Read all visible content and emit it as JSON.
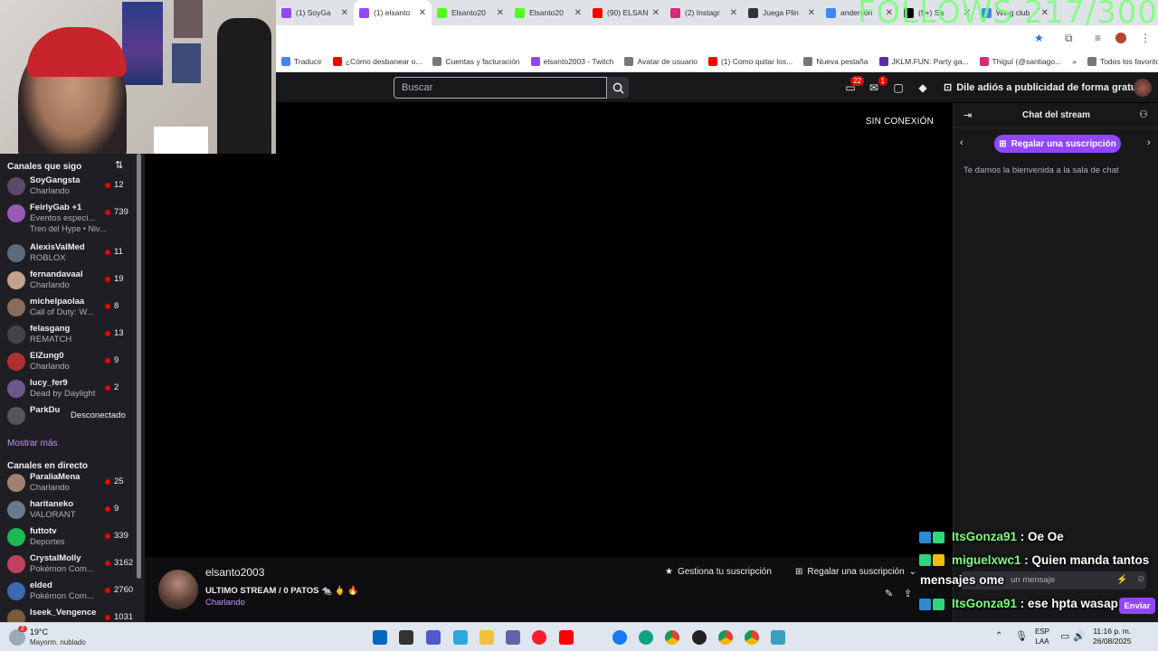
{
  "browser": {
    "tabs": [
      {
        "label": "(1) SoyGa",
        "color": "#9147ff",
        "active": false
      },
      {
        "label": "(1) elsanto",
        "color": "#9147ff",
        "active": true
      },
      {
        "label": "Elsanto20",
        "color": "#53fc18",
        "active": false
      },
      {
        "label": "Elsanto20",
        "color": "#53fc18",
        "active": false
      },
      {
        "label": "(90) ELSAN",
        "color": "#ff0000",
        "active": false
      },
      {
        "label": "(2) Instagr",
        "color": "#d62976",
        "active": false
      },
      {
        "label": "Juega Plin",
        "color": "#333333",
        "active": false
      },
      {
        "label": "anderson",
        "color": "#4285f4",
        "active": false
      },
      {
        "label": "(9+) Sa",
        "color": "#000000",
        "active": false
      },
      {
        "label": "Wing club",
        "color": "#4285f4",
        "active": false
      }
    ],
    "bookmarks": [
      {
        "label": "Traducir",
        "color": "#4285f4"
      },
      {
        "label": "¿Cómo desbanear o...",
        "color": "#ff0000"
      },
      {
        "label": "Cuentas y facturación",
        "color": "#777777"
      },
      {
        "label": "elsanto2003 - Twitch",
        "color": "#9147ff"
      },
      {
        "label": "Avatar de usuario",
        "color": "#777777"
      },
      {
        "label": "(1) Como quitar los...",
        "color": "#ff0000"
      },
      {
        "label": "Nueva pestaña",
        "color": "#777777"
      },
      {
        "label": "JKLM.FUN: Party ga...",
        "color": "#5b2ca0"
      },
      {
        "label": "Thiguí (@santiago...",
        "color": "#d62976"
      }
    ],
    "all_bookmarks": "Todos los favoritos"
  },
  "overlay": {
    "follows": "FOLLOWS 217/300"
  },
  "topbar": {
    "search_placeholder": "Buscar",
    "inbox_badge": "22",
    "notif_badge": "1",
    "ad_link": "Dile adiós a publicidad de forma gratuita"
  },
  "sidebar": {
    "followed_header": "Canales que sigo",
    "followed": [
      {
        "name": "SoyGangsta",
        "game": "Charlando",
        "viewers": "12",
        "color": "#5a4a6a"
      },
      {
        "name": "FeirlyGab +1",
        "game": "Eventos especi...",
        "viewers": "739",
        "color": "#9b59b6",
        "extra": "Tren del Hype • Niv..."
      },
      {
        "name": "AlexisValMed",
        "game": "ROBLOX",
        "viewers": "11",
        "color": "#5c6b7a"
      },
      {
        "name": "fernandavaal",
        "game": "Charlando",
        "viewers": "19",
        "color": "#c7a18f"
      },
      {
        "name": "michelpaolaa",
        "game": "Call of Duty: W...",
        "viewers": "8",
        "color": "#8a6b5a"
      },
      {
        "name": "felasgang",
        "game": "REMATCH",
        "viewers": "13",
        "color": "#444444"
      },
      {
        "name": "ElZung0",
        "game": "Charlando",
        "viewers": "9",
        "color": "#b03030"
      },
      {
        "name": "lucy_fer9",
        "game": "Dead by Daylight",
        "viewers": "2",
        "color": "#6a5a8a"
      },
      {
        "name": "ParkDu",
        "game": "",
        "viewers": "",
        "offline": "Desconectado",
        "color": "#555555"
      }
    ],
    "show_more": "Mostrar más",
    "live_header": "Canales en directo",
    "live": [
      {
        "name": "ParaliaMena",
        "game": "Charlando",
        "viewers": "25",
        "color": "#a08070"
      },
      {
        "name": "haritaneko",
        "game": "VALORANT",
        "viewers": "9",
        "color": "#6a7a8a"
      },
      {
        "name": "futtotv",
        "game": "Deportes",
        "viewers": "339",
        "color": "#1db954"
      },
      {
        "name": "CrystalMolly",
        "game": "Pokémon Com...",
        "viewers": "3162",
        "color": "#c04060"
      },
      {
        "name": "elded",
        "game": "Pokémon Com...",
        "viewers": "2760",
        "color": "#3a6ab0"
      },
      {
        "name": "Iseek_Vengence",
        "game": "",
        "viewers": "1031",
        "color": "#7a5a3a"
      }
    ]
  },
  "video": {
    "status": "SIN CONEXIÓN"
  },
  "stream": {
    "streamer": "elsanto2003",
    "title": "ULTIMO STREAM / 0 PATOS 🐀 🖕 🔥",
    "category": "Charlando",
    "manage_sub": "Gestiona tu suscripción",
    "gift_sub": "Regalar una suscripción"
  },
  "chat": {
    "title": "Chat del stream",
    "gift_button": "Regalar una suscripción",
    "welcome": "Te damos la bienvenida a la sala de chat",
    "input_placeholder": "un mensaje",
    "send": "Enviar",
    "overlay_messages": [
      {
        "user": "ItsGonza91",
        "text": "Oe Oe"
      },
      {
        "user": "miguelxwc1",
        "text": "Quien manda tantos"
      },
      {
        "user": "",
        "text": "mensajes ome"
      },
      {
        "user": "ItsGonza91",
        "text": "ese hpta wasap"
      }
    ]
  },
  "taskbar": {
    "weather_badge": "2",
    "temp": "19°C",
    "weather": "Mayorm. nublado",
    "lang_line1": "ESP",
    "lang_line2": "LAA",
    "time": "11:16 p. m.",
    "date": "26/08/2025"
  }
}
